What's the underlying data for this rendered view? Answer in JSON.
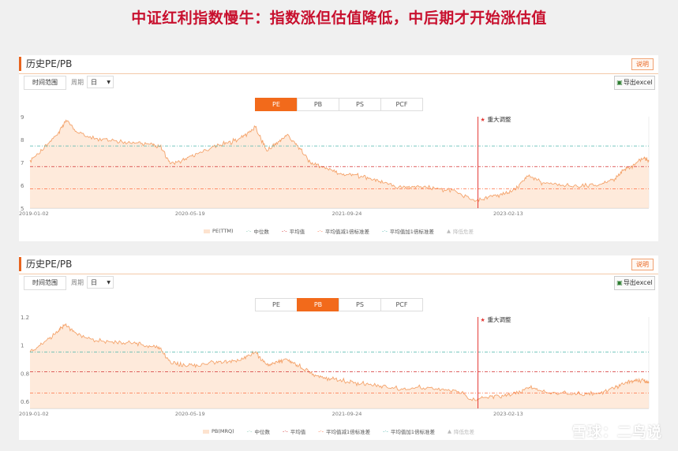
{
  "headline": "中证红利指数慢牛：指数涨但估值降低，中后期才开始涨估值",
  "panels": [
    {
      "title": "历史PE/PB",
      "explain_label": "说明",
      "range_label": "时间范围",
      "period_label": "周期",
      "period_value": "日",
      "export_label": "导出excel",
      "tabs": [
        "PE",
        "PB",
        "PS",
        "PCF"
      ],
      "active_tab": "PE",
      "event_label": "重大调整",
      "legend": [
        "PE(TTM)",
        "中位数",
        "平均值",
        "平均值减1倍标准差",
        "平均值加1倍标准差",
        "降低危差"
      ]
    },
    {
      "title": "历史PE/PB",
      "explain_label": "说明",
      "range_label": "时间范围",
      "period_label": "周期",
      "period_value": "日",
      "export_label": "导出excel",
      "tabs": [
        "PE",
        "PB",
        "PS",
        "PCF"
      ],
      "active_tab": "PB",
      "event_label": "重大调整",
      "legend": [
        "PB(MRQ)",
        "中位数",
        "平均值",
        "平均值减1倍标准差",
        "平均值加1倍标准差",
        "降低危差"
      ]
    }
  ],
  "watermark": "雪球：二鸟说",
  "colors": {
    "accent": "#f26a1b",
    "title_red": "#c8102e",
    "event_line": "#e53935",
    "median": "#7fc8b0",
    "mean": "#d32f2f",
    "mean_minus_sd": "#ff7043",
    "mean_plus_sd": "#4db6ac",
    "area": "#fde3cf",
    "line": "#f4a36b"
  },
  "chart_data": [
    {
      "type": "area",
      "series_name": "PE(TTM)",
      "x_ticks": [
        "2019-01-02",
        "2020-05-19",
        "2021-09-24",
        "2023-02-13"
      ],
      "y_ticks": [
        5,
        6,
        7,
        8,
        9
      ],
      "ylim": [
        5,
        9
      ],
      "xlim": [
        "2019-01-02",
        "2024-04-30"
      ],
      "event": {
        "date": "2022-11-10",
        "label": "重大调整"
      },
      "reference_lines": {
        "median": 7.72,
        "mean": 6.82,
        "mean_minus_sd": 5.85,
        "mean_plus_sd": 7.72
      },
      "points": [
        [
          "2019-01-02",
          7.1
        ],
        [
          "2019-02-15",
          7.6
        ],
        [
          "2019-04-01",
          8.3
        ],
        [
          "2019-04-25",
          8.85
        ],
        [
          "2019-06-01",
          8.3
        ],
        [
          "2019-08-01",
          8.05
        ],
        [
          "2019-10-01",
          7.95
        ],
        [
          "2019-12-01",
          7.85
        ],
        [
          "2020-01-15",
          7.8
        ],
        [
          "2020-02-15",
          7.7
        ],
        [
          "2020-03-20",
          6.95
        ],
        [
          "2020-05-01",
          7.1
        ],
        [
          "2020-06-15",
          7.4
        ],
        [
          "2020-08-01",
          7.7
        ],
        [
          "2020-09-15",
          7.85
        ],
        [
          "2020-11-01",
          8.1
        ],
        [
          "2020-12-10",
          8.55
        ],
        [
          "2021-01-15",
          7.5
        ],
        [
          "2021-02-20",
          7.9
        ],
        [
          "2021-03-20",
          8.2
        ],
        [
          "2021-04-20",
          7.75
        ],
        [
          "2021-06-01",
          7.0
        ],
        [
          "2021-07-15",
          6.8
        ],
        [
          "2021-09-01",
          6.5
        ],
        [
          "2021-10-15",
          6.45
        ],
        [
          "2021-12-01",
          6.3
        ],
        [
          "2022-01-15",
          6.1
        ],
        [
          "2022-03-15",
          5.9
        ],
        [
          "2022-05-01",
          5.95
        ],
        [
          "2022-07-01",
          5.85
        ],
        [
          "2022-09-01",
          5.75
        ],
        [
          "2022-10-31",
          5.3
        ],
        [
          "2022-12-15",
          5.5
        ],
        [
          "2023-02-01",
          5.6
        ],
        [
          "2023-03-15",
          5.9
        ],
        [
          "2023-04-20",
          6.45
        ],
        [
          "2023-06-01",
          6.1
        ],
        [
          "2023-08-01",
          6.0
        ],
        [
          "2023-10-01",
          5.95
        ],
        [
          "2023-12-01",
          6.05
        ],
        [
          "2024-01-15",
          6.3
        ],
        [
          "2024-02-15",
          6.7
        ],
        [
          "2024-03-15",
          6.9
        ],
        [
          "2024-04-15",
          7.2
        ],
        [
          "2024-04-30",
          7.05
        ]
      ]
    },
    {
      "type": "area",
      "series_name": "PB(MRQ)",
      "x_ticks": [
        "2019-01-02",
        "2020-05-19",
        "2021-09-24",
        "2023-02-13"
      ],
      "y_ticks": [
        0.6,
        0.8,
        1,
        1.2
      ],
      "ylim": [
        0.55,
        1.2
      ],
      "xlim": [
        "2019-01-02",
        "2024-04-30"
      ],
      "event": {
        "date": "2022-11-10",
        "label": "重大调整"
      },
      "reference_lines": {
        "median": 0.94,
        "mean": 0.81,
        "mean_minus_sd": 0.66,
        "mean_plus_sd": 0.95
      },
      "points": [
        [
          "2019-01-02",
          0.95
        ],
        [
          "2019-02-15",
          1.02
        ],
        [
          "2019-04-01",
          1.1
        ],
        [
          "2019-04-25",
          1.15
        ],
        [
          "2019-06-01",
          1.07
        ],
        [
          "2019-08-01",
          1.03
        ],
        [
          "2019-10-01",
          1.02
        ],
        [
          "2019-12-01",
          1.01
        ],
        [
          "2020-01-15",
          0.99
        ],
        [
          "2020-02-15",
          0.98
        ],
        [
          "2020-03-20",
          0.87
        ],
        [
          "2020-05-01",
          0.86
        ],
        [
          "2020-06-15",
          0.85
        ],
        [
          "2020-08-01",
          0.88
        ],
        [
          "2020-09-15",
          0.88
        ],
        [
          "2020-11-01",
          0.9
        ],
        [
          "2020-12-10",
          0.95
        ],
        [
          "2021-01-15",
          0.86
        ],
        [
          "2021-02-20",
          0.88
        ],
        [
          "2021-03-20",
          0.9
        ],
        [
          "2021-04-20",
          0.86
        ],
        [
          "2021-06-01",
          0.8
        ],
        [
          "2021-07-15",
          0.77
        ],
        [
          "2021-09-01",
          0.75
        ],
        [
          "2021-10-15",
          0.73
        ],
        [
          "2021-12-01",
          0.72
        ],
        [
          "2022-01-15",
          0.71
        ],
        [
          "2022-03-15",
          0.69
        ],
        [
          "2022-05-01",
          0.7
        ],
        [
          "2022-07-01",
          0.69
        ],
        [
          "2022-09-01",
          0.68
        ],
        [
          "2022-10-31",
          0.61
        ],
        [
          "2022-12-15",
          0.63
        ],
        [
          "2023-02-01",
          0.64
        ],
        [
          "2023-03-15",
          0.66
        ],
        [
          "2023-04-20",
          0.7
        ],
        [
          "2023-06-01",
          0.67
        ],
        [
          "2023-08-01",
          0.66
        ],
        [
          "2023-10-01",
          0.65
        ],
        [
          "2023-12-01",
          0.66
        ],
        [
          "2024-01-15",
          0.7
        ],
        [
          "2024-02-15",
          0.73
        ],
        [
          "2024-03-15",
          0.75
        ],
        [
          "2024-04-15",
          0.75
        ],
        [
          "2024-04-30",
          0.73
        ]
      ]
    }
  ]
}
